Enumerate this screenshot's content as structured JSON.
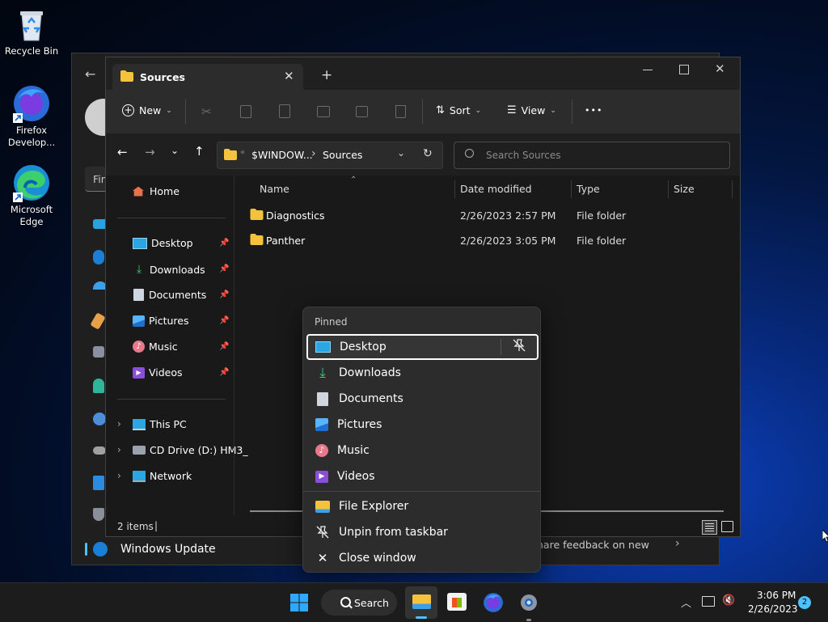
{
  "desktop": {
    "icons": [
      {
        "label_line1": "Recycle Bin",
        "label_line2": ""
      },
      {
        "label_line1": "Firefox",
        "label_line2": "Develop..."
      },
      {
        "label_line1": "Microsoft",
        "label_line2": "Edge"
      }
    ]
  },
  "settings_window": {
    "search_text": "Fin",
    "windows_update_label": "Windows Update",
    "feedback_text": "hare feedback on new"
  },
  "explorer": {
    "tab_title": "Sources",
    "new_tab_glyph": "+",
    "toolbar": {
      "new_label": "New",
      "sort_label": "Sort",
      "view_label": "View",
      "more_glyph": "•••"
    },
    "address": {
      "chevrons": "«",
      "segment_root": "$WINDOW...",
      "separator": "›",
      "segment_current": "Sources"
    },
    "search_placeholder": "Search Sources",
    "nav": {
      "home": "Home",
      "quick": [
        "Desktop",
        "Downloads",
        "Documents",
        "Pictures",
        "Music",
        "Videos"
      ],
      "locations": [
        "This PC",
        "CD Drive (D:) HM3_",
        "Network"
      ]
    },
    "columns": {
      "name": "Name",
      "date": "Date modified",
      "type": "Type",
      "size": "Size"
    },
    "files": [
      {
        "name": "Diagnostics",
        "date": "2/26/2023 2:57 PM",
        "type": "File folder"
      },
      {
        "name": "Panther",
        "date": "2/26/2023 3:05 PM",
        "type": "File folder"
      }
    ],
    "status_text": "2 items",
    "status_sep": "|"
  },
  "jumplist": {
    "heading": "Pinned",
    "pinned": [
      "Desktop",
      "Downloads",
      "Documents",
      "Pictures",
      "Music",
      "Videos"
    ],
    "tasks": [
      "File Explorer",
      "Unpin from taskbar",
      "Close window"
    ]
  },
  "taskbar": {
    "search_label": "Search",
    "time": "3:06 PM",
    "date": "2/26/2023",
    "notification_count": "2"
  },
  "colors": {
    "accent": "#4cc2ff",
    "folder": "#f5c33b"
  }
}
